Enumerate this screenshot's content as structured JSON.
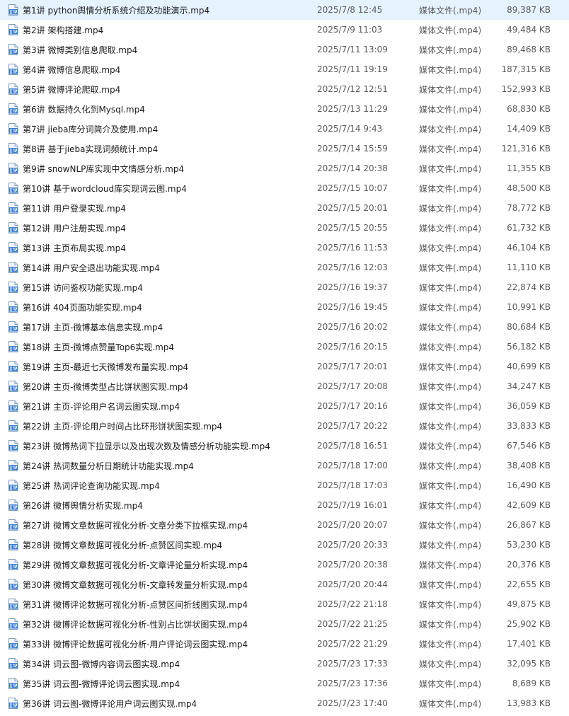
{
  "icon": "mp4-video-file-icon",
  "files": [
    {
      "name": "第1讲 python舆情分析系统介绍及功能演示.mp4",
      "date": "2025/7/8 12:45",
      "type": "媒体文件(.mp4)",
      "size": "89,387 KB"
    },
    {
      "name": "第2讲 架构搭建.mp4",
      "date": "2025/7/9 11:03",
      "type": "媒体文件(.mp4)",
      "size": "49,484 KB"
    },
    {
      "name": "第3讲 微博类别信息爬取.mp4",
      "date": "2025/7/11 13:09",
      "type": "媒体文件(.mp4)",
      "size": "89,468 KB"
    },
    {
      "name": "第4讲 微博信息爬取.mp4",
      "date": "2025/7/11 19:19",
      "type": "媒体文件(.mp4)",
      "size": "187,315 KB"
    },
    {
      "name": "第5讲 微博评论爬取.mp4",
      "date": "2025/7/12 12:51",
      "type": "媒体文件(.mp4)",
      "size": "152,993 KB"
    },
    {
      "name": "第6讲 数据持久化到Mysql.mp4",
      "date": "2025/7/13 11:29",
      "type": "媒体文件(.mp4)",
      "size": "68,830 KB"
    },
    {
      "name": "第7讲 jieba库分词简介及使用.mp4",
      "date": "2025/7/14 9:43",
      "type": "媒体文件(.mp4)",
      "size": "14,409 KB"
    },
    {
      "name": "第8讲 基于jieba实现词频统计.mp4",
      "date": "2025/7/14 15:59",
      "type": "媒体文件(.mp4)",
      "size": "121,316 KB"
    },
    {
      "name": "第9讲 snowNLP库实现中文情感分析.mp4",
      "date": "2025/7/14 20:38",
      "type": "媒体文件(.mp4)",
      "size": "11,355 KB"
    },
    {
      "name": "第10讲 基于wordcloud库实现词云图.mp4",
      "date": "2025/7/15 10:07",
      "type": "媒体文件(.mp4)",
      "size": "48,500 KB"
    },
    {
      "name": "第11讲 用户登录实现.mp4",
      "date": "2025/7/15 20:01",
      "type": "媒体文件(.mp4)",
      "size": "78,772 KB"
    },
    {
      "name": "第12讲 用户注册实现.mp4",
      "date": "2025/7/15 20:55",
      "type": "媒体文件(.mp4)",
      "size": "61,732 KB"
    },
    {
      "name": "第13讲 主页布局实现.mp4",
      "date": "2025/7/16 11:53",
      "type": "媒体文件(.mp4)",
      "size": "46,104 KB"
    },
    {
      "name": "第14讲 用户安全退出功能实现.mp4",
      "date": "2025/7/16 12:03",
      "type": "媒体文件(.mp4)",
      "size": "11,110 KB"
    },
    {
      "name": "第15讲 访问鉴权功能实现.mp4",
      "date": "2025/7/16 19:37",
      "type": "媒体文件(.mp4)",
      "size": "22,874 KB"
    },
    {
      "name": "第16讲 404页面功能实现.mp4",
      "date": "2025/7/16 19:45",
      "type": "媒体文件(.mp4)",
      "size": "10,991 KB"
    },
    {
      "name": "第17讲 主页-微博基本信息实现.mp4",
      "date": "2025/7/16 20:02",
      "type": "媒体文件(.mp4)",
      "size": "80,684 KB"
    },
    {
      "name": "第18讲 主页-微博点赞量Top6实现.mp4",
      "date": "2025/7/16 20:15",
      "type": "媒体文件(.mp4)",
      "size": "56,182 KB"
    },
    {
      "name": "第19讲 主页-最近七天微博发布量实现.mp4",
      "date": "2025/7/17 20:01",
      "type": "媒体文件(.mp4)",
      "size": "40,699 KB"
    },
    {
      "name": "第20讲 主页-微博类型占比饼状图实现.mp4",
      "date": "2025/7/17 20:08",
      "type": "媒体文件(.mp4)",
      "size": "34,247 KB"
    },
    {
      "name": "第21讲 主页-评论用户名词云图实现.mp4",
      "date": "2025/7/17 20:16",
      "type": "媒体文件(.mp4)",
      "size": "36,059 KB"
    },
    {
      "name": "第22讲 主页-评论用户时间占比环形饼状图实现.mp4",
      "date": "2025/7/17 20:22",
      "type": "媒体文件(.mp4)",
      "size": "33,833 KB"
    },
    {
      "name": "第23讲 微博热词下拉显示以及出现次数及情感分析功能实现.mp4",
      "date": "2025/7/18 16:51",
      "type": "媒体文件(.mp4)",
      "size": "67,546 KB"
    },
    {
      "name": "第24讲 热词数量分析日期统计功能实现.mp4",
      "date": "2025/7/18 17:00",
      "type": "媒体文件(.mp4)",
      "size": "38,408 KB"
    },
    {
      "name": "第25讲 热词评论查询功能实现.mp4",
      "date": "2025/7/18 17:03",
      "type": "媒体文件(.mp4)",
      "size": "16,490 KB"
    },
    {
      "name": "第26讲 微博舆情分析实现.mp4",
      "date": "2025/7/19 16:01",
      "type": "媒体文件(.mp4)",
      "size": "42,609 KB"
    },
    {
      "name": "第27讲 微博文章数据可视化分析-文章分类下拉框实现.mp4",
      "date": "2025/7/20 20:07",
      "type": "媒体文件(.mp4)",
      "size": "26,867 KB"
    },
    {
      "name": "第28讲 微博文章数据可视化分析-点赞区间实现.mp4",
      "date": "2025/7/20 20:33",
      "type": "媒体文件(.mp4)",
      "size": "53,230 KB"
    },
    {
      "name": "第29讲 微博文章数据可视化分析-文章评论量分析实现.mp4",
      "date": "2025/7/20 20:38",
      "type": "媒体文件(.mp4)",
      "size": "20,376 KB"
    },
    {
      "name": "第30讲 微博文章数据可视化分析-文章转发量分析实现.mp4",
      "date": "2025/7/20 20:44",
      "type": "媒体文件(.mp4)",
      "size": "22,655 KB"
    },
    {
      "name": "第31讲 微博评论数据可视化分析-点赞区间折线图实现.mp4",
      "date": "2025/7/22 21:18",
      "type": "媒体文件(.mp4)",
      "size": "49,875 KB"
    },
    {
      "name": "第32讲 微博评论数据可视化分析-性别占比饼状图实现.mp4",
      "date": "2025/7/22 21:25",
      "type": "媒体文件(.mp4)",
      "size": "25,902 KB"
    },
    {
      "name": "第33讲 微博评论数据可视化分析-用户评论词云图实现.mp4",
      "date": "2025/7/22 21:29",
      "type": "媒体文件(.mp4)",
      "size": "17,401 KB"
    },
    {
      "name": "第34讲 词云图-微博内容词云图实现.mp4",
      "date": "2025/7/23 17:33",
      "type": "媒体文件(.mp4)",
      "size": "32,095 KB"
    },
    {
      "name": "第35讲 词云图-微博评论词云图实现.mp4",
      "date": "2025/7/23 17:36",
      "type": "媒体文件(.mp4)",
      "size": "8,689 KB"
    },
    {
      "name": "第36讲 词云图-微博评论用户词云图实现.mp4",
      "date": "2025/7/23 17:40",
      "type": "媒体文件(.mp4)",
      "size": "13,983 KB"
    }
  ]
}
